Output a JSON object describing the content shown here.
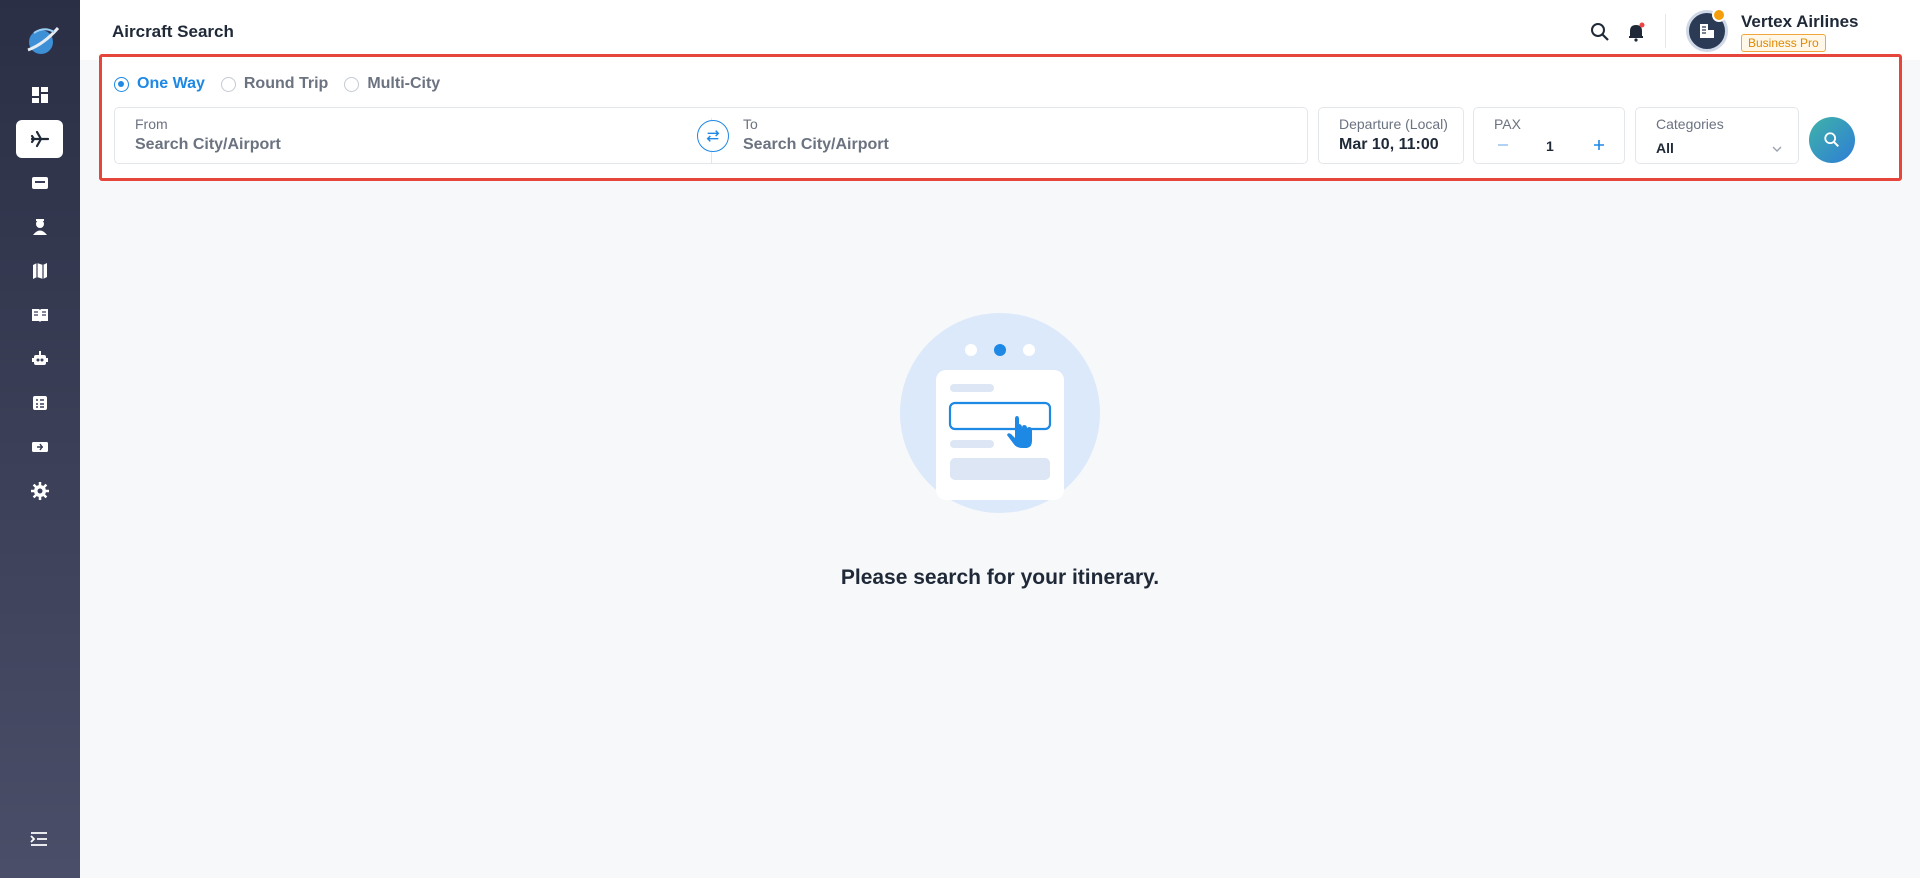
{
  "header": {
    "title": "Aircraft Search",
    "company": "Vertex Airlines",
    "plan": "Business Pro"
  },
  "sidebar": {
    "items": [
      {
        "icon": "dashboard-icon",
        "active": false
      },
      {
        "icon": "airplane-icon",
        "active": true
      },
      {
        "icon": "ticket-icon",
        "active": false
      },
      {
        "icon": "pilot-icon",
        "active": false
      },
      {
        "icon": "map-icon",
        "active": false
      },
      {
        "icon": "book-icon",
        "active": false
      },
      {
        "icon": "robot-icon",
        "active": false
      },
      {
        "icon": "checklist-icon",
        "active": false
      },
      {
        "icon": "boarding-pass-icon",
        "active": false
      },
      {
        "icon": "gear-icon",
        "active": false
      }
    ]
  },
  "search": {
    "trip_types": [
      "One Way",
      "Round Trip",
      "Multi-City"
    ],
    "selected_trip_type": "One Way",
    "from_label": "From",
    "from_placeholder": "Search City/Airport",
    "to_label": "To",
    "to_placeholder": "Search City/Airport",
    "departure_label": "Departure (Local)",
    "departure_value": "Mar 10, 11:00",
    "pax_label": "PAX",
    "pax_value": "1",
    "categories_label": "Categories",
    "categories_value": "All"
  },
  "empty_state": {
    "message": "Please search for your itinerary."
  },
  "colors": {
    "accent": "#1e88e5",
    "sidebar": "#2b2f45",
    "highlight_border": "#e5453a"
  }
}
